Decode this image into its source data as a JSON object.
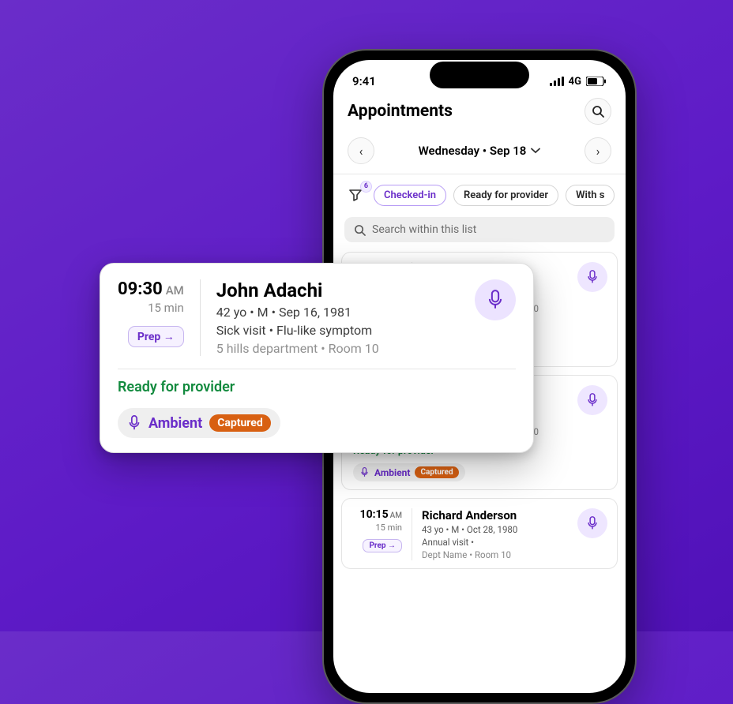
{
  "statusbar": {
    "time": "9:41",
    "network": "4G"
  },
  "header": {
    "title": "Appointments"
  },
  "datebar": {
    "label": "Wednesday • Sep 18"
  },
  "filters": {
    "badge": "6",
    "chips": [
      {
        "label": "Checked-in",
        "active": true
      },
      {
        "label": "Ready for provider",
        "active": false
      },
      {
        "label": "With s",
        "active": false
      }
    ]
  },
  "search": {
    "placeholder": "Search within this list"
  },
  "expanded": {
    "time": "09:30",
    "ampm": "AM",
    "duration": "15 min",
    "prep": "Prep →",
    "name": "John Adachi",
    "meta": "42 yo • M • Sep 16, 1981",
    "visit": "Sick visit • Flu-like symptom",
    "location": "5 hills department • Room 10",
    "status": "Ready for provider",
    "ambient_label": "Ambient",
    "captured": "Captured"
  },
  "appointments": [
    {
      "time": "09:30",
      "ampm": "AM",
      "duration": "15 min",
      "prep": "Prep →",
      "name": "John Adachi",
      "meta": "42 yo • M • Sep 16, 1981",
      "visit": "Sick visit • Flu-like symptom",
      "location": "5 hills department • Room 10",
      "status": "Ready for provider",
      "ambient_label": "Ambient",
      "captured": "Captured"
    },
    {
      "time": "09:30",
      "ampm": "AM",
      "duration": "15 min",
      "prep": "Prep →",
      "name": "John Adachi",
      "meta": "42 yo • M • Sep 16, 1981",
      "visit": "Sick visit • Flu-like symptom",
      "location": "5 hills department • Room 10",
      "status": "Ready for provider",
      "ambient_label": "Ambient",
      "captured": "Captured"
    },
    {
      "time": "10:15",
      "ampm": "AM",
      "duration": "15 min",
      "prep": "Prep →",
      "name": "Richard Anderson",
      "meta": "43 yo • M • Oct 28, 1980",
      "visit": "Annual visit •",
      "location": "Dept Name • Room 10",
      "status": "",
      "ambient_label": "",
      "captured": ""
    }
  ]
}
